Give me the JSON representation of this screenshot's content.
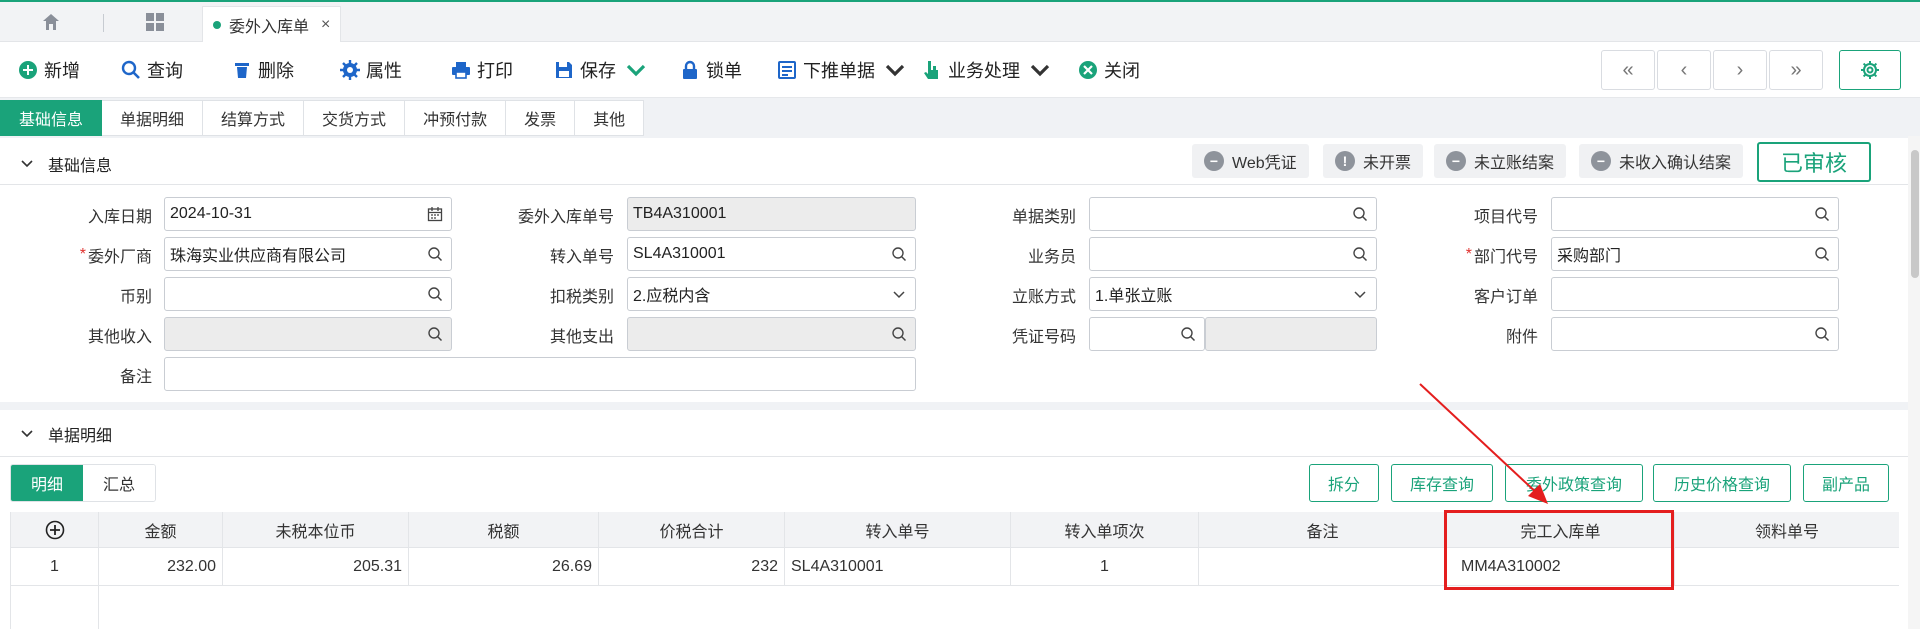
{
  "tabbar": {
    "doc_tab": "委外入库单",
    "close": "×"
  },
  "toolbar": {
    "new": "新增",
    "query": "查询",
    "delete": "删除",
    "props": "属性",
    "print": "打印",
    "save": "保存",
    "lock": "锁单",
    "push": "下推单据",
    "business": "业务处理",
    "close": "关闭",
    "nav": [
      "«",
      "‹",
      "›",
      "»"
    ]
  },
  "section_tabs": [
    "基础信息",
    "单据明细",
    "结算方式",
    "交货方式",
    "冲预付款",
    "发票",
    "其他"
  ],
  "basic": {
    "title": "基础信息",
    "status": [
      "Web凭证",
      "未开票",
      "未立账结案",
      "未收入确认结案"
    ],
    "approved": "已审核",
    "fields": {
      "in_date": {
        "label": "入库日期",
        "value": "2024-10-31"
      },
      "vendor": {
        "label": "委外厂商",
        "value": "珠海实业供应商有限公司"
      },
      "currency": {
        "label": "币别",
        "value": ""
      },
      "other_income": {
        "label": "其他收入",
        "value": ""
      },
      "remark": {
        "label": "备注",
        "value": ""
      },
      "outsource_no": {
        "label": "委外入库单号",
        "value": "TB4A310001"
      },
      "transfer_no": {
        "label": "转入单号",
        "value": "SL4A310001"
      },
      "tax_type": {
        "label": "扣税类别",
        "value": "2.应税内含"
      },
      "other_expense": {
        "label": "其他支出",
        "value": ""
      },
      "doc_type": {
        "label": "单据类别",
        "value": ""
      },
      "salesman": {
        "label": "业务员",
        "value": ""
      },
      "account_method": {
        "label": "立账方式",
        "value": "1.单张立账"
      },
      "voucher_no": {
        "label": "凭证号码",
        "value": ""
      },
      "project_code": {
        "label": "项目代号",
        "value": ""
      },
      "dept_code": {
        "label": "部门代号",
        "value": "采购部门"
      },
      "customer_order": {
        "label": "客户订单",
        "value": ""
      },
      "attachment": {
        "label": "附件",
        "value": ""
      }
    }
  },
  "detail": {
    "title": "单据明细",
    "subtabs": [
      "明细",
      "汇总"
    ],
    "actions": [
      "拆分",
      "库存查询",
      "委外政策查询",
      "历史价格查询",
      "副产品"
    ],
    "columns": [
      "金额",
      "未税本位币",
      "税额",
      "价税合计",
      "转入单号",
      "转入单项次",
      "备注",
      "完工入库单",
      "领料单号"
    ],
    "rows": [
      {
        "idx": "1",
        "amount": "232.00",
        "untaxed": "205.31",
        "tax": "26.69",
        "total": "232",
        "transfer_no": "SL4A310001",
        "transfer_item": "1",
        "remark": "",
        "completion_no": "MM4A310002",
        "material_no": ""
      }
    ]
  }
}
